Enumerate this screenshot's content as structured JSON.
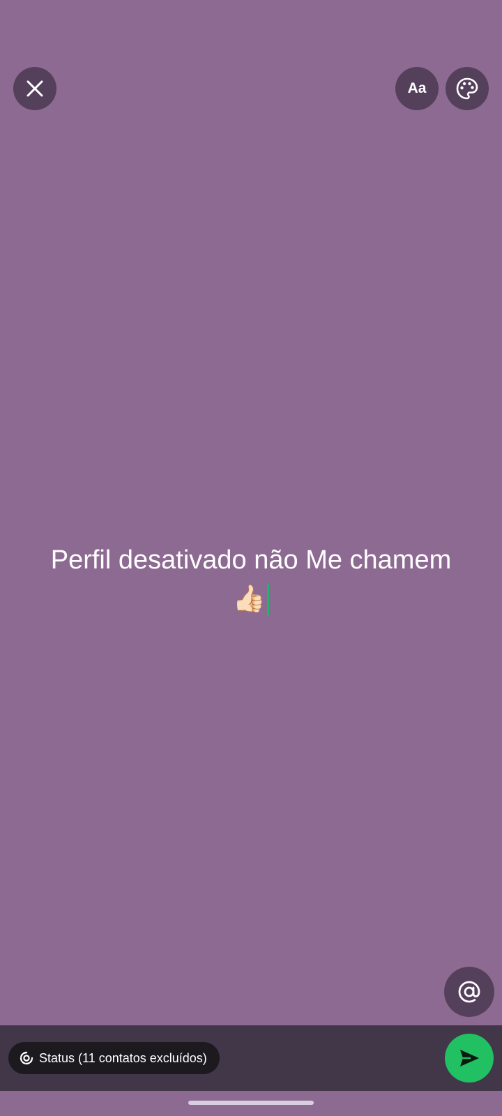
{
  "theme": {
    "background": "#8d6a91",
    "send_button": "#21c063",
    "cursor": "#1fb36b"
  },
  "top_bar": {
    "close_icon": "close-icon",
    "font_button_label": "Aa",
    "palette_icon": "palette-icon"
  },
  "editor": {
    "text_line1": "Perfil desativado não Me chamem",
    "emoji": "👍🏻"
  },
  "mention_icon": "at-sign-icon",
  "bottom_bar": {
    "audience_icon": "status-ring-icon",
    "audience_label": "Status (11 contatos excluídos)",
    "send_icon": "send-icon"
  }
}
